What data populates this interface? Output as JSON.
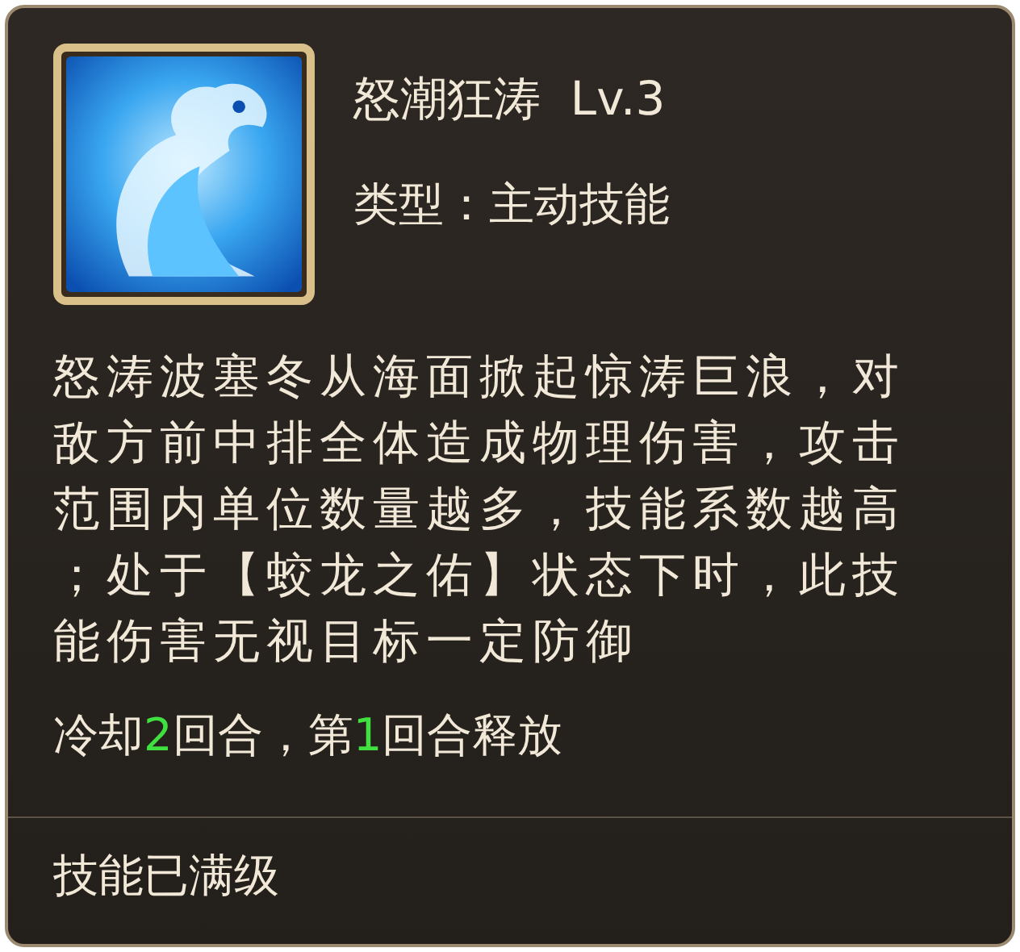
{
  "skill": {
    "name": "怒潮狂涛",
    "level": "Lv.3",
    "type_label": "类型：主动技能",
    "description": "怒涛波塞冬从海面掀起惊涛巨浪，对敌方前中排全体造成物理伤害，攻击范围内单位数量越多，技能系数越高；处于【蛟龙之佑】状态下时，此技能伤害无视目标一定防御",
    "cooldown": [
      {
        "text": "冷却",
        "highlight": false
      },
      {
        "text": "2",
        "highlight": true
      },
      {
        "text": "回合，第",
        "highlight": false
      },
      {
        "text": "1",
        "highlight": true
      },
      {
        "text": "回合释放",
        "highlight": false
      }
    ],
    "status": "技能已满级"
  }
}
